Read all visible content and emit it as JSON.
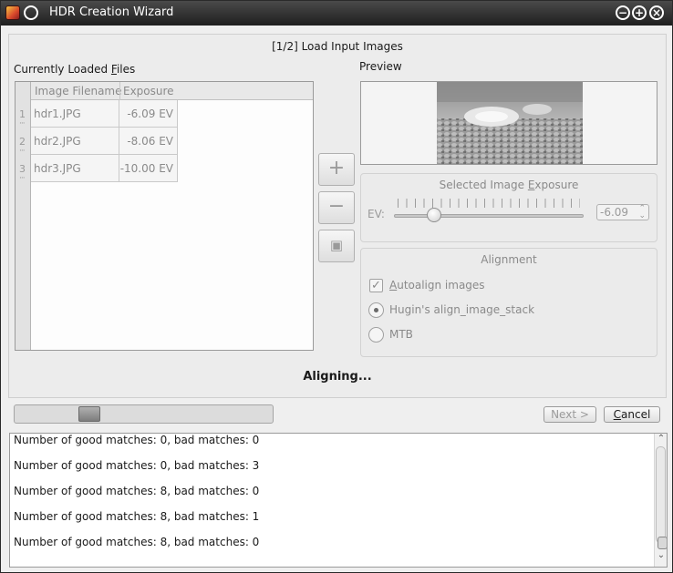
{
  "window": {
    "title": "HDR Creation Wizard",
    "controls": {
      "minimize": "−",
      "maximize": "+",
      "close": "×"
    }
  },
  "wizard": {
    "step_title": "[1/2] Load Input Images",
    "files_label": "Currently Loaded Files",
    "table": {
      "columns": [
        "Image Filename",
        "Exposure"
      ],
      "rows": [
        {
          "num": "1",
          "filename": "hdr1.JPG",
          "exposure": "-6.09 EV"
        },
        {
          "num": "2",
          "filename": "hdr2.JPG",
          "exposure": "-8.06 EV"
        },
        {
          "num": "3",
          "filename": "hdr3.JPG",
          "exposure": "-10.00 EV"
        }
      ]
    },
    "buttons": {
      "add": "+",
      "remove": "−",
      "preview": "▣"
    },
    "preview_label": "Preview",
    "exposure_group": {
      "title": "Selected Image Exposure",
      "ev_label": "EV:",
      "ev_value": "-6.09",
      "slider_fraction": 0.2
    },
    "alignment_group": {
      "title": "Alignment",
      "autoalign_label": "Autoalign images",
      "autoalign_checked": true,
      "options": [
        {
          "label": "Hugin's align_image_stack",
          "selected": true
        },
        {
          "label": "MTB",
          "selected": false
        }
      ]
    },
    "status": "Aligning..."
  },
  "footer": {
    "next_label": "Next >",
    "cancel_label": "Cancel"
  },
  "log": {
    "lines": [
      "Number of good matches: 0, bad matches: 0",
      "Number of good matches: 0, bad matches: 3",
      "Number of good matches: 8, bad matches: 0",
      "Number of good matches: 8, bad matches: 1",
      "Number of good matches: 8, bad matches: 0"
    ]
  }
}
